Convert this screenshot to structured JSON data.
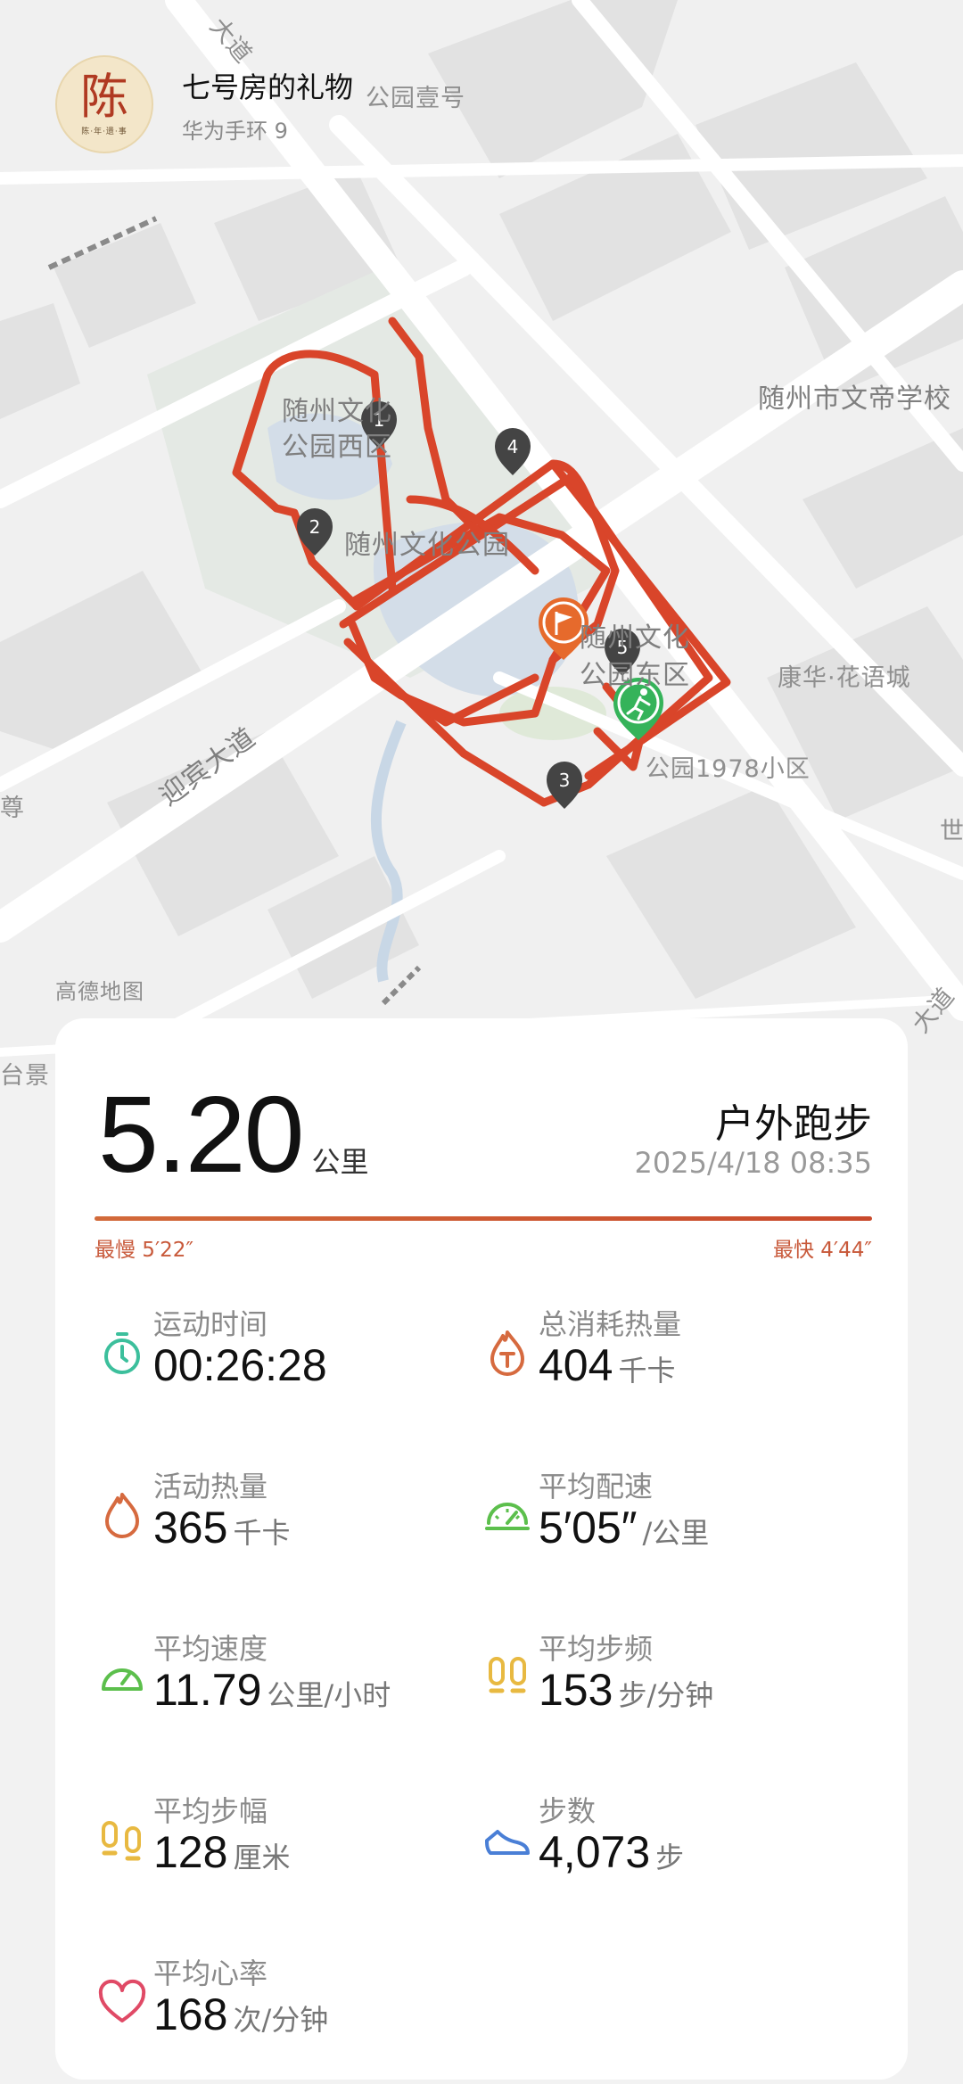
{
  "header": {
    "avatar_char": "陈",
    "avatar_sub": "陈·年·遗·事",
    "user_name": "七号房的礼物",
    "device_name": "华为手环 9"
  },
  "map": {
    "labels": {
      "park_top": "公园壹号",
      "suizhou_school": "随州市文帝学校",
      "park_west_1": "随州文化",
      "park_west_2": "公园西区",
      "park_center": "随州文化公园",
      "park_east_1": "随州文化",
      "park_east_2": "公园东区",
      "kanghua": "康华·花语城",
      "community": "公园1978小区",
      "yingbin": "迎宾大道",
      "gaode": "高德地图",
      "zun": "尊",
      "taijing": "台景",
      "shi": "世",
      "dadao_top": "大道",
      "dadao_right": "大道"
    },
    "markers": [
      "1",
      "2",
      "3",
      "4",
      "5"
    ],
    "route_color": "#d9452a"
  },
  "summary": {
    "distance": "5.20",
    "distance_unit": "公里",
    "workout_type": "户外跑步",
    "start_time": "2025/4/18 08:35",
    "slowest": "最慢 5′22″",
    "fastest": "最快 4′44″"
  },
  "stats": [
    {
      "label": "运动时间",
      "value": "00:26:28",
      "unit": "",
      "icon": "stopwatch-icon",
      "color": "#3cbf9c"
    },
    {
      "label": "总消耗热量",
      "value": "404",
      "unit": "千卡",
      "icon": "calorie-flame-t-icon",
      "color": "#d66a3f"
    },
    {
      "label": "活动热量",
      "value": "365",
      "unit": "千卡",
      "icon": "flame-icon",
      "color": "#d66a3f"
    },
    {
      "label": "平均配速",
      "value": "5′05″",
      "unit": "/公里",
      "icon": "pace-gauge-icon",
      "color": "#5cbf4c"
    },
    {
      "label": "平均速度",
      "value": "11.79",
      "unit": "公里/小时",
      "icon": "speedometer-icon",
      "color": "#5cbf4c"
    },
    {
      "label": "平均步频",
      "value": "153",
      "unit": "步/分钟",
      "icon": "footprints-icon",
      "color": "#e8b941"
    },
    {
      "label": "平均步幅",
      "value": "128",
      "unit": "厘米",
      "icon": "footprints-stride-icon",
      "color": "#e8b941"
    },
    {
      "label": "步数",
      "value": "4,073",
      "unit": "步",
      "icon": "shoe-icon",
      "color": "#4a7fd6"
    },
    {
      "label": "平均心率",
      "value": "168",
      "unit": "次/分钟",
      "icon": "heart-icon",
      "color": "#e04a66"
    }
  ]
}
